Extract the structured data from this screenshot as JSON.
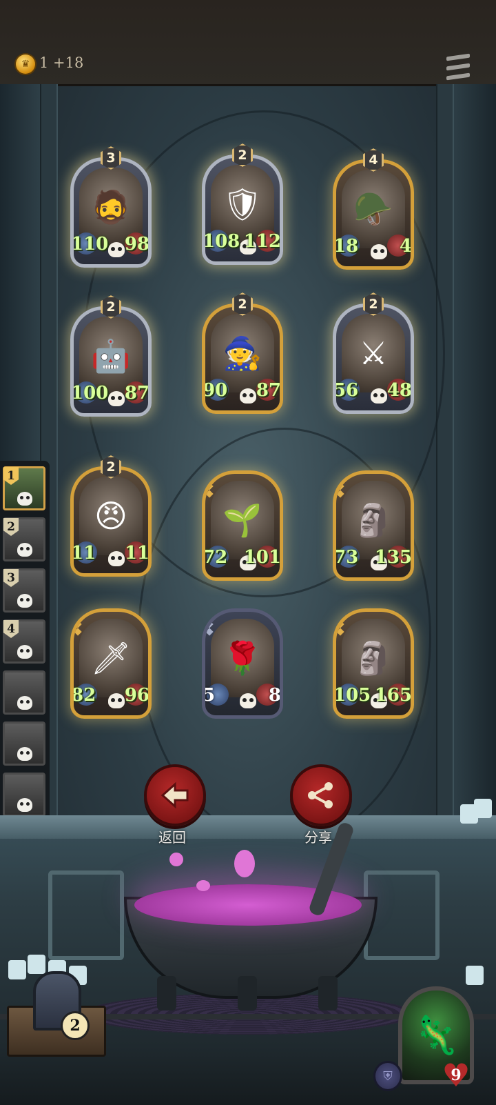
{
  "header": {
    "coin_text": "1 +18",
    "coin_icon": "crown-coin-icon",
    "menu_icon": "hamburger-menu-icon"
  },
  "cards": [
    {
      "level": "3",
      "attack": "110",
      "health": "98",
      "frame": "silver",
      "portrait": "🧔"
    },
    {
      "level": "2",
      "attack": "108",
      "health": "112",
      "frame": "silver",
      "portrait": "🛡"
    },
    {
      "level": "4",
      "attack": "18",
      "health": "4",
      "frame": "gold",
      "portrait": "🪖"
    },
    {
      "level": "2",
      "attack": "100",
      "health": "87",
      "frame": "silver",
      "portrait": "🤖"
    },
    {
      "level": "2",
      "attack": "90",
      "health": "87",
      "frame": "gold",
      "portrait": "🧙"
    },
    {
      "level": "2",
      "attack": "56",
      "health": "48",
      "frame": "silver",
      "portrait": "⚔"
    },
    {
      "level": "2",
      "attack": "11",
      "health": "11",
      "frame": "gold",
      "portrait": "😠"
    },
    {
      "level": "",
      "attack": "72",
      "health": "101",
      "frame": "gold",
      "portrait": "🌱"
    },
    {
      "level": "",
      "attack": "73",
      "health": "135",
      "frame": "gold",
      "portrait": "🗿"
    },
    {
      "level": "",
      "attack": "82",
      "health": "96",
      "frame": "gold",
      "portrait": "🗡"
    },
    {
      "level": "",
      "attack": "5",
      "health": "8",
      "frame": "plain",
      "portrait": "🌹"
    },
    {
      "level": "",
      "attack": "105",
      "health": "165",
      "frame": "gold",
      "portrait": "🗿"
    }
  ],
  "party": [
    {
      "badge": "1",
      "active": true
    },
    {
      "badge": "2",
      "active": false
    },
    {
      "badge": "3",
      "active": false
    },
    {
      "badge": "4",
      "active": false
    },
    {
      "badge": "",
      "active": false
    },
    {
      "badge": "",
      "active": false
    },
    {
      "badge": "",
      "active": false
    },
    {
      "badge": "",
      "active": false
    }
  ],
  "actions": {
    "back_label": "返回",
    "share_label": "分享"
  },
  "chest": {
    "count": "2"
  },
  "hero": {
    "health": "9",
    "portrait": "🦎"
  }
}
